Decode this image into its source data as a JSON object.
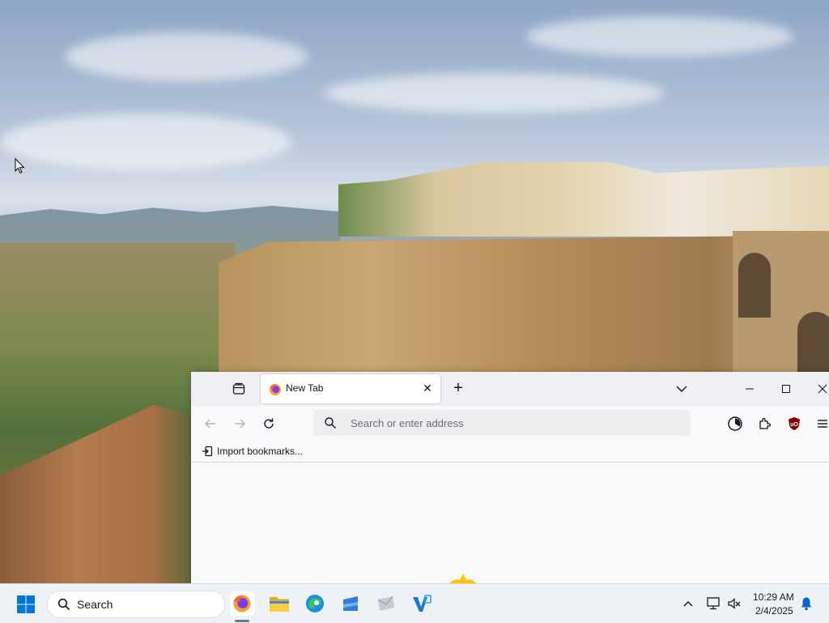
{
  "browser": {
    "tab": {
      "title": "New Tab",
      "close_symbol": "✕"
    },
    "new_tab_symbol": "+",
    "urlbar": {
      "placeholder": "Search or enter address"
    },
    "bookmarks_bar": {
      "import_label": "Import bookmarks..."
    },
    "icons": {
      "tab_list": "firefox-view-icon",
      "list_all_tabs": "chevron-down-icon",
      "back": "arrow-left-icon",
      "forward": "arrow-right-icon",
      "reload": "reload-icon",
      "search": "search-icon",
      "account": "account-icon",
      "extensions": "puzzle-icon",
      "ublock": "ublock-origin-icon",
      "menu": "hamburger-menu-icon"
    }
  },
  "taskbar": {
    "search_label": "Search",
    "apps": [
      "firefox",
      "file-explorer",
      "edge",
      "microsoft-store",
      "mail",
      "vs-code"
    ],
    "clock": {
      "time": "10:29 AM",
      "date": "2/4/2025"
    }
  },
  "colors": {
    "window_bg": "#f9f9fb",
    "titlebar_bg": "#f0f0f4",
    "urlbar_bg": "#eeeef1",
    "taskbar_bg": "#eef1f6",
    "windows_blue": "#0078d4",
    "ublock_red": "#800000"
  }
}
